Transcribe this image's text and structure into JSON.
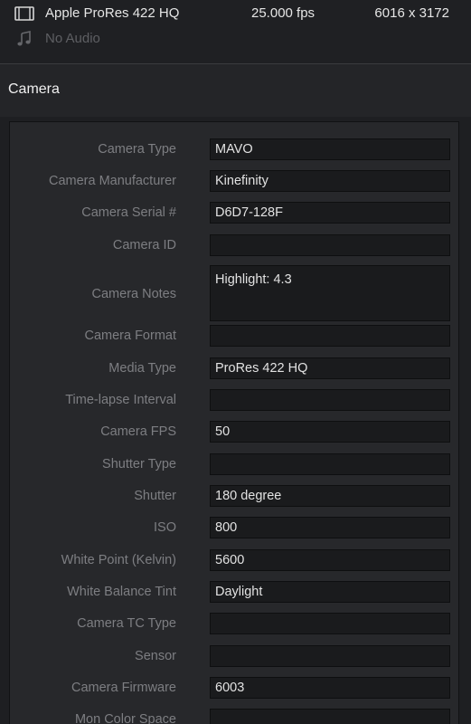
{
  "media_info": {
    "codec": "Apple ProRes 422 HQ",
    "fps": "25.000 fps",
    "resolution": "6016 x 3172",
    "audio": "No Audio"
  },
  "section": {
    "title": "Camera"
  },
  "fields": [
    {
      "label": "Camera Type",
      "value": "MAVO"
    },
    {
      "label": "Camera Manufacturer",
      "value": "Kinefinity"
    },
    {
      "label": "Camera Serial #",
      "value": "D6D7-128F"
    },
    {
      "label": "Camera ID",
      "value": ""
    },
    {
      "label": "Camera Notes",
      "value": "Highlight: 4.3"
    },
    {
      "label": "Camera Format",
      "value": ""
    },
    {
      "label": "Media Type",
      "value": "ProRes 422 HQ"
    },
    {
      "label": "Time-lapse Interval",
      "value": ""
    },
    {
      "label": "Camera FPS",
      "value": "50"
    },
    {
      "label": "Shutter Type",
      "value": ""
    },
    {
      "label": "Shutter",
      "value": "180 degree"
    },
    {
      "label": "ISO",
      "value": "800"
    },
    {
      "label": "White Point (Kelvin)",
      "value": "5600"
    },
    {
      "label": "White Balance Tint",
      "value": "Daylight"
    },
    {
      "label": "Camera TC Type",
      "value": ""
    },
    {
      "label": "Sensor",
      "value": ""
    },
    {
      "label": "Camera Firmware",
      "value": "6003"
    },
    {
      "label": "Mon Color Space",
      "value": ""
    }
  ]
}
